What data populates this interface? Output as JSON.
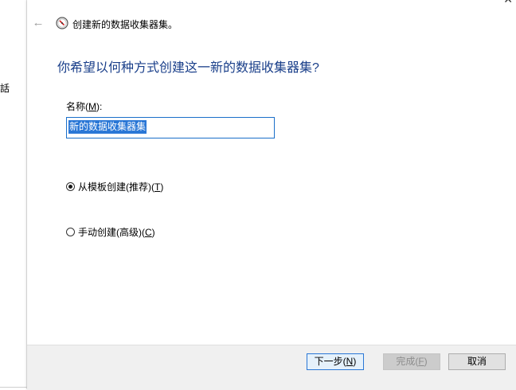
{
  "background": {
    "side_text": "話"
  },
  "wizard": {
    "title": "创建新的数据收集器集。",
    "question": "你希望以何种方式创建这一新的数据收集器集?",
    "name_label_prefix": "名称(",
    "name_label_key": "M",
    "name_label_suffix": "):",
    "name_value": "新的数据收集器集",
    "options": [
      {
        "prefix": "从模板创建(推荐)(",
        "key": "T",
        "suffix": ")",
        "checked": true
      },
      {
        "prefix": "手动创建(高级)(",
        "key": "C",
        "suffix": ")",
        "checked": false
      }
    ],
    "buttons": {
      "next_prefix": "下一步(",
      "next_key": "N",
      "next_suffix": ")",
      "finish_prefix": "完成(",
      "finish_key": "F",
      "finish_suffix": ")",
      "cancel": "取消"
    }
  },
  "colors": {
    "question_text": "#1a3f8a",
    "selection": "#2a77d6",
    "footer_bg": "#f0f0f0"
  },
  "icons": {
    "back": "back-arrow-icon",
    "wizard": "performance-monitor-icon",
    "close": "close-icon"
  }
}
